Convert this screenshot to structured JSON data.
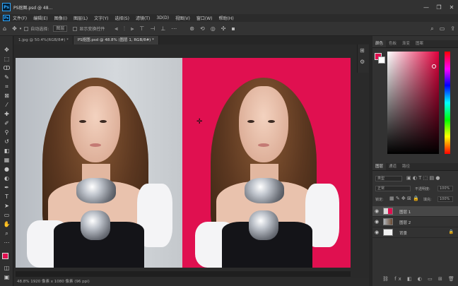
{
  "window": {
    "title": "PS抠图.psd @ 48...",
    "app_badge": "Ps",
    "controls": [
      "—",
      "❐",
      "✕"
    ]
  },
  "menu": [
    "文件(F)",
    "编辑(E)",
    "图像(I)",
    "图层(L)",
    "文字(Y)",
    "选择(S)",
    "滤镜(T)",
    "3D(D)",
    "视图(V)",
    "窗口(W)",
    "帮助(H)"
  ],
  "options": {
    "auto_select_label": "自动选择:",
    "auto_select_value": "图层",
    "transform_label": "显示变换控件"
  },
  "tabs": [
    {
      "label": "1.jpg @ 50.4%(RGB/8#) *",
      "active": false
    },
    {
      "label": "PS抠图.psd @ 48.8% (图层 1, RGB/8#) *",
      "active": true
    }
  ],
  "status": "48.8%    1920 像素 x 1080 像素 (96 ppi)",
  "panels": {
    "color_tabs": [
      "颜色",
      "色板",
      "渐变",
      "图案"
    ],
    "layers_tabs": [
      "图层",
      "通道",
      "路径"
    ],
    "kind_filter": "类型",
    "blend_mode": "正常",
    "opacity_label": "不透明度:",
    "opacity_value": "100%",
    "lock_label": "锁定:",
    "fill_label": "填充:",
    "fill_value": "100%",
    "layers": [
      {
        "name": "图层 1",
        "active": true
      },
      {
        "name": "图层 2",
        "active": false
      },
      {
        "name": "背景",
        "active": false
      }
    ]
  },
  "colors": {
    "foreground": "#e01050",
    "background": "#ffffff"
  }
}
